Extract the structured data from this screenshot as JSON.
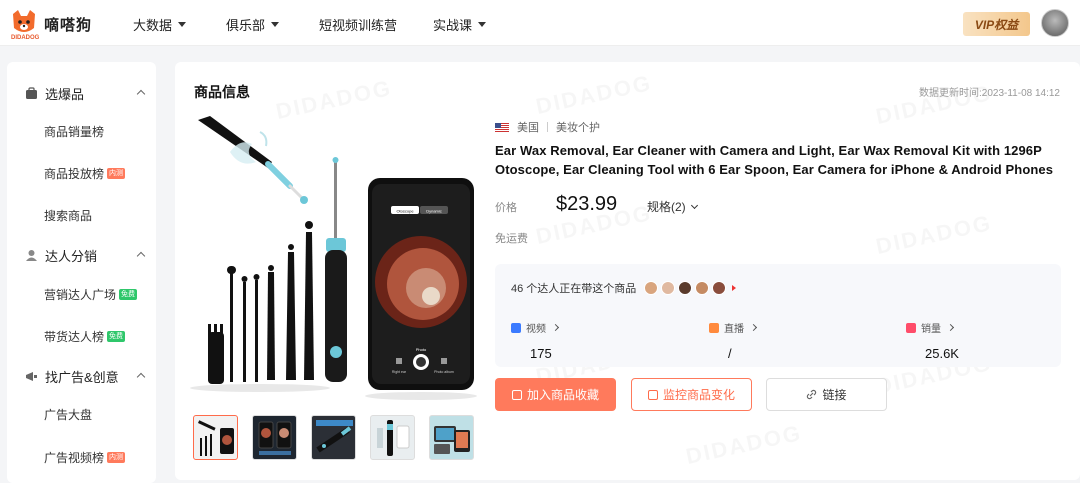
{
  "topbar": {
    "brand_name": "嘀嗒狗",
    "brand_logo_text": "DIDADOG",
    "nav": [
      {
        "label": "大数据",
        "has_dropdown": true
      },
      {
        "label": "俱乐部",
        "has_dropdown": true
      },
      {
        "label": "短视频训练营",
        "has_dropdown": false
      },
      {
        "label": "实战课",
        "has_dropdown": true
      }
    ],
    "vip_label": "VIP权益"
  },
  "sidebar": {
    "groups": [
      {
        "label": "选爆品",
        "icon": "bag-icon",
        "items": [
          {
            "label": "商品销量榜",
            "tag": ""
          },
          {
            "label": "商品投放榜",
            "tag": "内测"
          },
          {
            "label": "搜索商品",
            "tag": ""
          }
        ]
      },
      {
        "label": "达人分销",
        "icon": "user-icon",
        "items": [
          {
            "label": "营销达人广场",
            "tag": "免费"
          },
          {
            "label": "带货达人榜",
            "tag": "免费"
          }
        ]
      },
      {
        "label": "找广告&创意",
        "icon": "megaphone-icon",
        "items": [
          {
            "label": "广告大盘",
            "tag": ""
          },
          {
            "label": "广告视频榜",
            "tag": "内测"
          }
        ]
      }
    ]
  },
  "product": {
    "section_title": "商品信息",
    "update_time": "数据更新时间:2023-11-08 14:12",
    "country": "美国",
    "category": "美妆个护",
    "title": "Ear Wax Removal, Ear Cleaner with Camera and Light, Ear Wax Removal Kit with 1296P Otoscope, Ear Cleaning Tool with 6 Ear Spoon, Ear Camera for iPhone & Android Phones",
    "price_label": "价格",
    "price": "$23.99",
    "spec_label": "规格(2)",
    "shipping": "免运费",
    "phone_tabs": [
      "Otoscope",
      "Dynamic"
    ],
    "phone_controls": [
      "Right ear",
      "Photo",
      "Photo album"
    ],
    "kol_text": "46 个达人正在带这个商品",
    "stats": [
      {
        "label": "视频",
        "value": "175",
        "color": "#3b7bff"
      },
      {
        "label": "直播",
        "value": "/",
        "color": "#ff8a3d"
      },
      {
        "label": "销量",
        "value": "25.6K",
        "color": "#ff4d6a"
      }
    ],
    "buttons": {
      "favorite": "加入商品收藏",
      "monitor": "监控商品变化",
      "link": "链接"
    },
    "watermark": "DIDADOG"
  },
  "colors": {
    "accent": "#ff7a5c",
    "tag_red": "#ff7a5c",
    "tag_green": "#2fc76b"
  }
}
